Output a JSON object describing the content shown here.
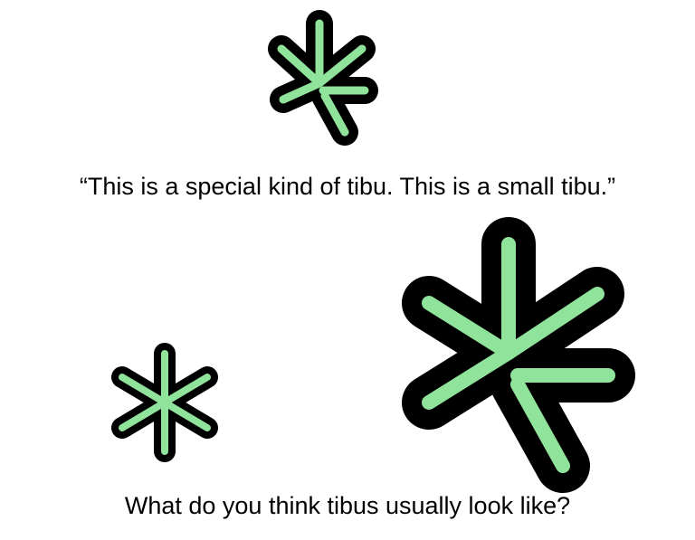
{
  "colors": {
    "figure_fill": "#90e39a",
    "figure_outline": "#000000",
    "background": "#ffffff",
    "text": "#000000"
  },
  "figures": [
    {
      "name": "small-tibu-figure",
      "shape": "six-arm star, lower-right arm bent/split"
    },
    {
      "name": "typical-tibu-figure",
      "shape": "regular six-arm star"
    },
    {
      "name": "large-tibu-figure",
      "shape": "six-arm star, lower-right arm bent/split"
    }
  ],
  "captions": {
    "top": "“This is a special kind of tibu. This is a small tibu.”",
    "bottom": "What do you think tibus usually look like?"
  }
}
